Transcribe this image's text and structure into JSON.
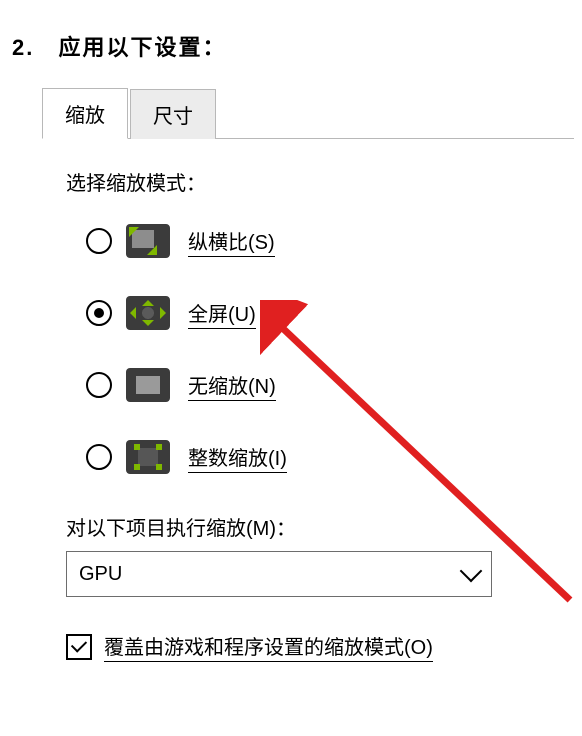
{
  "step": {
    "number": "2.",
    "title": "应用以下设置："
  },
  "tabs": {
    "scaling": "缩放",
    "size": "尺寸"
  },
  "scaling": {
    "section_label": "选择缩放模式：",
    "options": {
      "aspect": {
        "label": "纵横比(S)",
        "hotkey": "S",
        "selected": false
      },
      "full": {
        "label": "全屏(U)",
        "hotkey": "U",
        "selected": true
      },
      "none": {
        "label": "无缩放(N)",
        "hotkey": "N",
        "selected": false
      },
      "integer": {
        "label": "整数缩放(I)",
        "hotkey": "I",
        "selected": false
      }
    },
    "perform_on": {
      "label": "对以下项目执行缩放(M)：",
      "hotkey": "M",
      "selected_value": "GPU"
    },
    "override": {
      "label": "覆盖由游戏和程序设置的缩放模式(O)",
      "hotkey": "O",
      "checked": true
    }
  },
  "annotation": {
    "type": "arrow",
    "color": "#e02020",
    "points_to": "radio-fullscreen"
  }
}
